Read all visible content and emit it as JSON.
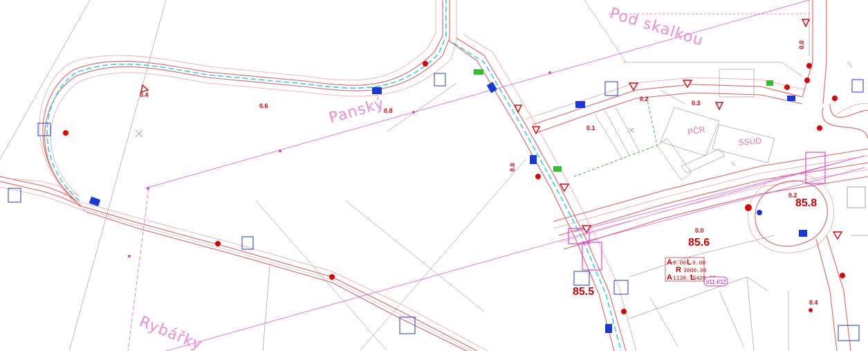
{
  "streets": {
    "pod_skalkou": "Pod skalkou",
    "pansky": "Panský",
    "rybarky": "Rybářky"
  },
  "buildings": {
    "pcr": "PČR",
    "ssud": "SSÚD"
  },
  "chainage": {
    "c04": "0.4",
    "c06": "0.6",
    "c08": "0.8",
    "c00a": "0.0",
    "c01": "0.1",
    "c02": "0.2",
    "c03": "0.3",
    "c00b": "0.0",
    "c00c": "0.0",
    "c02b": "0.2",
    "c04b": "0.4"
  },
  "km_marks": {
    "k856": "85.6",
    "k858": "85.8",
    "k85x": "85.5"
  },
  "curve": {
    "a1_label": "A",
    "a1_value": "0.00",
    "l1_label": "L",
    "l1_value": "0.00",
    "r_label": "R",
    "r_value": "3000.00",
    "a2_label": "A",
    "a2_value": "1130.75",
    "l2_label": "L",
    "l2_value": "420.00"
  },
  "road_number": "I/11-I/12",
  "colors": {
    "road": "#e06060",
    "cyan_marking": "#2ad4e8",
    "sign_red": "#e00000",
    "sign_blue": "#1838d8",
    "magenta": "#e040e0",
    "street_label": "#f08cd2"
  }
}
